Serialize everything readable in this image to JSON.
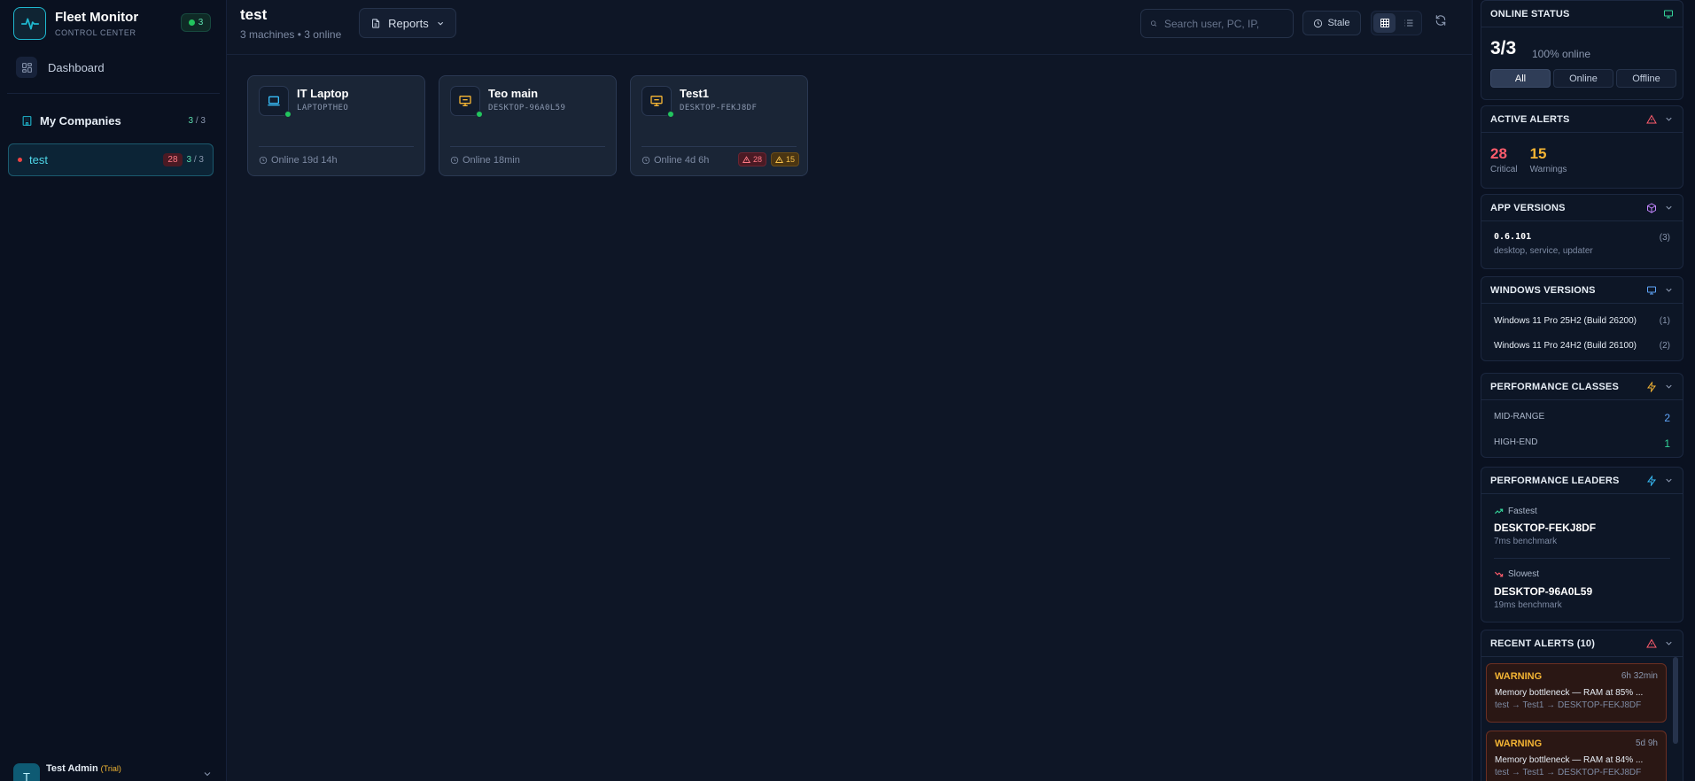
{
  "sidebar": {
    "brand_title": "Fleet Monitor",
    "brand_subtitle": "CONTROL CENTER",
    "online_count": "3",
    "dashboard_label": "Dashboard",
    "companies_label": "My Companies",
    "companies_online": "3",
    "companies_total": "/ 3",
    "company": {
      "name": "test",
      "alert_count": "28",
      "online": "3",
      "total": "/ 3"
    },
    "user": {
      "initial": "T",
      "name": "Test Admin",
      "plan": "(Trial)"
    }
  },
  "header": {
    "title": "test",
    "subtitle": "3 machines • 3 online",
    "reports_label": "Reports",
    "search_placeholder": "Search user, PC, IP,",
    "stale_label": "Stale"
  },
  "machines": [
    {
      "name": "IT Laptop",
      "host": "LAPTOPTHEO",
      "status": "Online 19d 14h",
      "icon": "laptop-icon",
      "icon_color": "#38bdf8",
      "critical": "",
      "warnings": ""
    },
    {
      "name": "Teo main",
      "host": "DESKTOP-96A0L59",
      "status": "Online 18min",
      "icon": "desktop-icon",
      "icon_color": "#f5b534",
      "critical": "",
      "warnings": ""
    },
    {
      "name": "Test1",
      "host": "DESKTOP-FEKJ8DF",
      "status": "Online 4d 6h",
      "icon": "desktop-icon",
      "icon_color": "#f5b534",
      "critical": "28",
      "warnings": "15"
    }
  ],
  "right_panel": {
    "online_status": {
      "title": "ONLINE STATUS",
      "count": "3/3",
      "percent": "100% online",
      "filters": [
        "All",
        "Online",
        "Offline"
      ],
      "active_filter": "All"
    },
    "active_alerts": {
      "title": "ACTIVE ALERTS",
      "critical": "28",
      "critical_label": "Critical",
      "warnings": "15",
      "warnings_label": "Warnings"
    },
    "app_versions": {
      "title": "APP VERSIONS",
      "version": "0.6.101",
      "components": "desktop, service, updater",
      "count": "(3)"
    },
    "windows_versions": {
      "title": "WINDOWS VERSIONS",
      "items": [
        {
          "name": "Windows 11 Pro 25H2 (Build 26200)",
          "count": "(1)"
        },
        {
          "name": "Windows 11 Pro 24H2 (Build 26100)",
          "count": "(2)"
        }
      ]
    },
    "performance_classes": {
      "title": "PERFORMANCE CLASSES",
      "items": [
        {
          "name": "MID-RANGE",
          "count": "2"
        },
        {
          "name": "HIGH-END",
          "count": "1"
        }
      ]
    },
    "performance_leaders": {
      "title": "PERFORMANCE LEADERS",
      "fastest_label": "Fastest",
      "fastest_host": "DESKTOP-FEKJ8DF",
      "fastest_bench": "7ms benchmark",
      "slowest_label": "Slowest",
      "slowest_host": "DESKTOP-96A0L59",
      "slowest_bench": "19ms benchmark"
    },
    "recent_alerts": {
      "title": "RECENT ALERTS (10)",
      "items": [
        {
          "type": "WARNING",
          "time": "6h 32min",
          "message": "Memory bottleneck — RAM at 85% ...",
          "path": "test → Test1 → DESKTOP-FEKJ8DF"
        },
        {
          "type": "WARNING",
          "time": "5d 9h",
          "message": "Memory bottleneck — RAM at 84% ...",
          "path": "test → Test1 → DESKTOP-FEKJ8DF"
        }
      ]
    }
  },
  "colors": {
    "accent": "#1fb8cf",
    "online": "#22c55e",
    "critical": "#ff5c6c",
    "warning": "#f5b534",
    "background": "#0e1626"
  }
}
